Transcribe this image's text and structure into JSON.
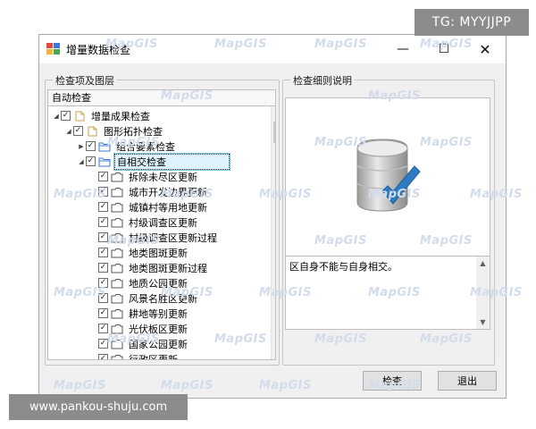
{
  "overlay": {
    "top_right": "TG: MYYJJPP",
    "bottom_left": "www.pankou-shuju.com"
  },
  "window": {
    "title": "增量数据检查",
    "controls": {
      "minimize": "—",
      "maximize": "☐",
      "close": "✕"
    }
  },
  "left_panel": {
    "group_label": "检查项及图层",
    "column_header": "自动检查",
    "nodes": [
      {
        "label": "增量成果检查",
        "level": 0,
        "expander": "◢",
        "checked": true,
        "icon": "document-icon"
      },
      {
        "label": "图形拓扑检查",
        "level": 1,
        "expander": "◢",
        "checked": true,
        "icon": "document-icon"
      },
      {
        "label": "组合要素检查",
        "level": 2,
        "expander": "▶",
        "checked": true,
        "icon": "folder-icon"
      },
      {
        "label": "自相交检查",
        "level": 2,
        "expander": "◢",
        "checked": true,
        "icon": "folder-icon",
        "selected": true
      },
      {
        "label": "拆除未尽区更新",
        "level": 3,
        "checked": true,
        "icon": "layer-icon"
      },
      {
        "label": "城市开发边界更新",
        "level": 3,
        "checked": true,
        "icon": "layer-icon"
      },
      {
        "label": "城镇村等用地更新",
        "level": 3,
        "checked": true,
        "icon": "layer-icon"
      },
      {
        "label": "村级调查区更新",
        "level": 3,
        "checked": true,
        "icon": "layer-icon"
      },
      {
        "label": "村级调查区更新过程",
        "level": 3,
        "checked": true,
        "icon": "layer-icon"
      },
      {
        "label": "地类图斑更新",
        "level": 3,
        "checked": true,
        "icon": "layer-icon"
      },
      {
        "label": "地类图斑更新过程",
        "level": 3,
        "checked": true,
        "icon": "layer-icon"
      },
      {
        "label": "地质公园更新",
        "level": 3,
        "checked": true,
        "icon": "layer-icon"
      },
      {
        "label": "风景名胜区更新",
        "level": 3,
        "checked": true,
        "icon": "layer-icon"
      },
      {
        "label": "耕地等别更新",
        "level": 3,
        "checked": true,
        "icon": "layer-icon"
      },
      {
        "label": "光伏板区更新",
        "level": 3,
        "checked": true,
        "icon": "layer-icon"
      },
      {
        "label": "国家公园更新",
        "level": 3,
        "checked": true,
        "icon": "layer-icon"
      },
      {
        "label": "行政区更新",
        "level": 3,
        "checked": true,
        "icon": "layer-icon"
      }
    ]
  },
  "right_panel": {
    "group_label": "检查细则说明",
    "image_icon": "database-check-icon",
    "description": "区自身不能与自身相交。"
  },
  "buttons": {
    "check": "检查",
    "exit": "退出"
  },
  "watermark": "MapGIS",
  "colors": {
    "selection_bg": "#ddf2fb",
    "selection_border": "#74c2e3",
    "check_accent": "#2d7cc1",
    "watermark": "#d2dcec"
  }
}
